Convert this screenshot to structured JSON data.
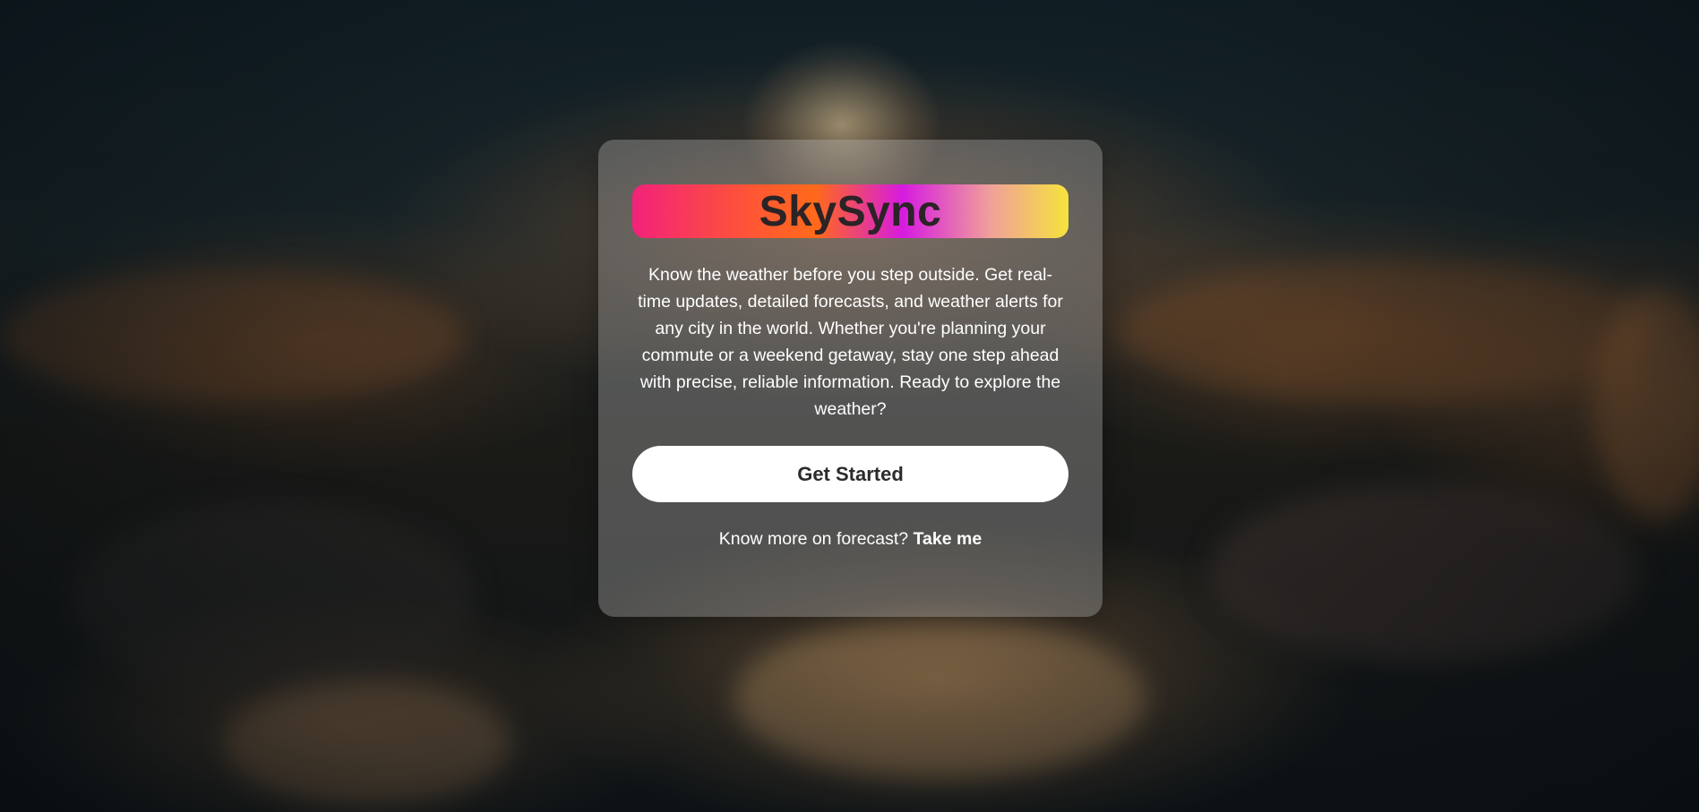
{
  "app": {
    "name": "SkySync"
  },
  "hero": {
    "title": "SkySync",
    "description": "Know the weather before you step outside. Get real-time updates, detailed forecasts, and weather alerts for any city in the world. Whether you're planning your commute or a weekend getaway, stay one step ahead with precise, reliable information. Ready to explore the weather?",
    "cta_label": "Get Started",
    "more_text": "Know more on forecast?",
    "more_link_label": "Take me"
  },
  "colors": {
    "logo_gradient": [
      "#f2227a",
      "#ff5733",
      "#ff6a1a",
      "#d61be0",
      "#f0a09a",
      "#f6e33c"
    ],
    "card_background": "rgba(160,160,160,0.42)",
    "button_background": "#ffffff"
  }
}
